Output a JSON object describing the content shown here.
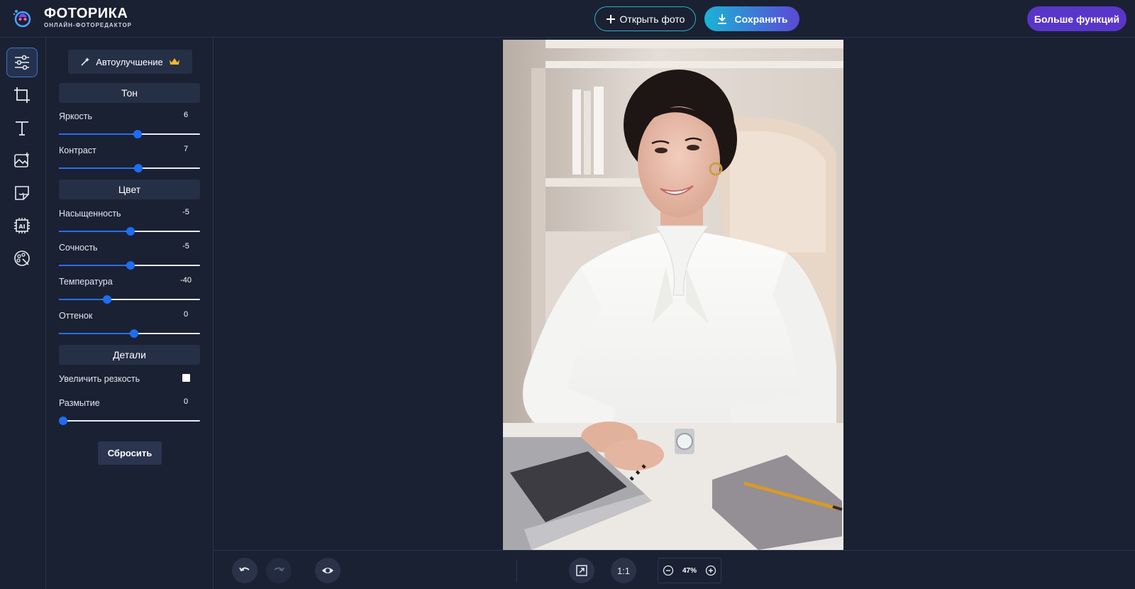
{
  "header": {
    "app_name": "ФОТОРИКА",
    "app_tagline": "ОНЛАЙН-ФОТОРЕДАКТОР",
    "open_photo": "Открыть фото",
    "save": "Сохранить",
    "more_features": "Больше функций"
  },
  "rail": {
    "items": [
      "adjust-icon",
      "crop-icon",
      "text-icon",
      "add-image-icon",
      "sticker-icon",
      "ai-icon",
      "palette-icon"
    ],
    "active": "adjust-icon"
  },
  "panel": {
    "auto_enhance": "Автоулучшение",
    "sections": {
      "tone": "Тон",
      "color": "Цвет",
      "details": "Детали"
    },
    "sliders": {
      "brightness": {
        "label": "Яркость",
        "value": "6",
        "fraction": 0.53
      },
      "contrast": {
        "label": "Контраст",
        "value": "7",
        "fraction": 0.535
      },
      "saturation": {
        "label": "Насыщенность",
        "value": "-5",
        "fraction": 0.475
      },
      "vibrance": {
        "label": "Сочность",
        "value": "-5",
        "fraction": 0.475
      },
      "temperature": {
        "label": "Температура",
        "value": "-40",
        "fraction": 0.31
      },
      "tint": {
        "label": "Оттенок",
        "value": "0",
        "fraction": 0.5
      },
      "blur": {
        "label": "Размытие",
        "value": "0",
        "fraction": 0.0
      }
    },
    "sharpen": {
      "label": "Увеличить резкость",
      "checked": false
    },
    "reset": "Сбросить"
  },
  "toolbar": {
    "ratio_label": "1:1",
    "zoom": "47%"
  },
  "colors": {
    "bg": "#1a2133",
    "accent": "#1f6cf5",
    "save_gradient_start": "#1ab3d4",
    "save_gradient_end": "#5a49d6",
    "more_button": "#5a35c9"
  }
}
